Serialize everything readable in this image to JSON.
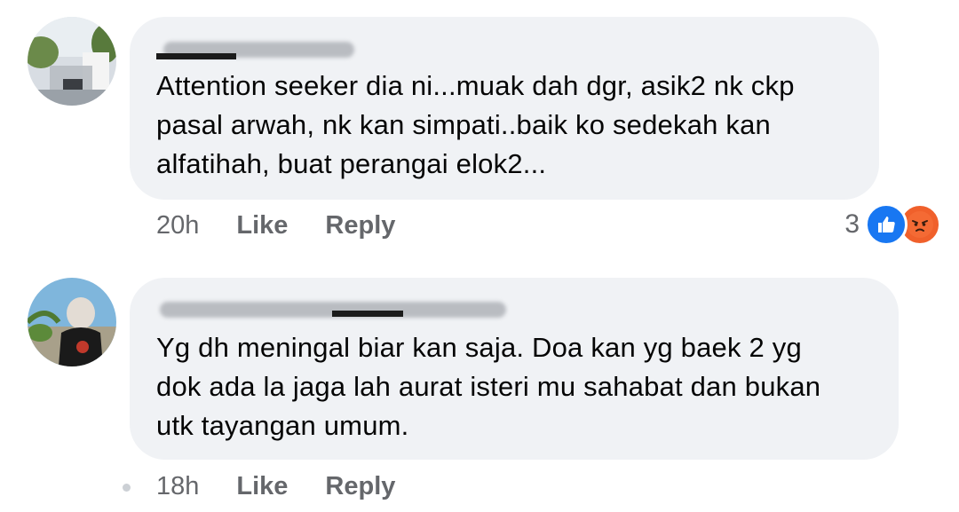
{
  "comments": [
    {
      "text_lines": [
        "Attention seeker dia ni...muak dah dgr, asik2 nk ckp",
        "pasal arwah, nk kan simpati..baik ko sedekah kan",
        "alfatihah, buat perangai elok2..."
      ],
      "time": "20h",
      "like_label": "Like",
      "reply_label": "Reply",
      "reaction_count": "3",
      "reactions": [
        "like-icon",
        "angry-icon"
      ]
    },
    {
      "text_lines": [
        "Yg dh meningal  biar kan saja.  Doa kan yg baek 2 yg",
        "dok ada la jaga lah aurat isteri mu sahabat dan bukan",
        "utk tayangan umum."
      ],
      "time": "18h",
      "like_label": "Like",
      "reply_label": "Reply"
    }
  ],
  "colors": {
    "bubble": "#f0f2f5",
    "meta_text": "#65676b",
    "like_blue": "#1877f2",
    "angry_orange": "#f0602b"
  }
}
